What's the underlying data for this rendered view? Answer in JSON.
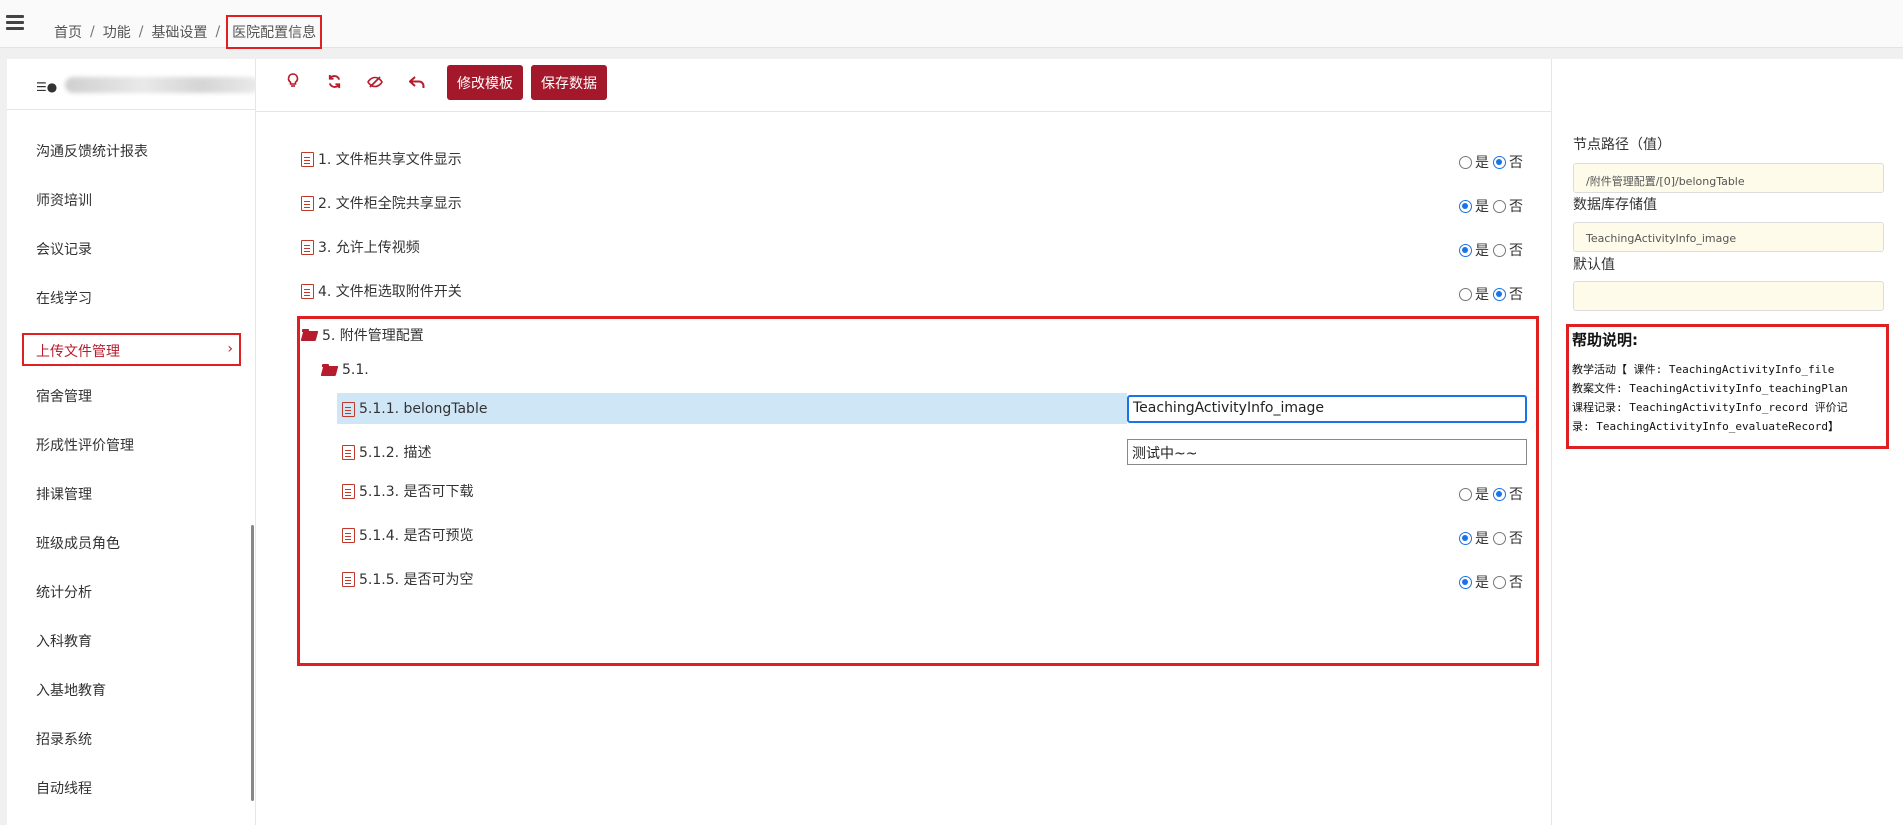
{
  "breadcrumb": {
    "items": [
      "首页",
      "功能",
      "基础设置"
    ],
    "current": "医院配置信息",
    "separator": "/"
  },
  "sidebar": {
    "header_icon": "server-icon",
    "items": [
      {
        "label": "沟通反馈统计报表"
      },
      {
        "label": "师资培训"
      },
      {
        "label": "会议记录"
      },
      {
        "label": "在线学习"
      },
      {
        "label": "上传文件管理",
        "active": true
      },
      {
        "label": "宿舍管理"
      },
      {
        "label": "形成性评价管理"
      },
      {
        "label": "排课管理"
      },
      {
        "label": "班级成员角色"
      },
      {
        "label": "统计分析"
      },
      {
        "label": "入科教育"
      },
      {
        "label": "入基地教育"
      },
      {
        "label": "招录系统"
      },
      {
        "label": "自动线程"
      }
    ]
  },
  "toolbar": {
    "icons": [
      "lightbulb-icon",
      "refresh-icon",
      "eye-slash-icon",
      "undo-icon"
    ],
    "edit_template_label": "修改模板",
    "save_data_label": "保存数据"
  },
  "tree": {
    "yes_label": "是",
    "no_label": "否",
    "items": [
      {
        "label": "1. 文件柜共享文件显示",
        "value": "否"
      },
      {
        "label": "2. 文件柜全院共享显示",
        "value": "是"
      },
      {
        "label": "3. 允许上传视频",
        "value": "是"
      },
      {
        "label": "4. 文件柜选取附件开关",
        "value": "否"
      }
    ],
    "group": {
      "label": "5. 附件管理配置",
      "sub_label": "5.1.",
      "children": [
        {
          "label": "5.1.1. belongTable",
          "input_value": "TeachingActivityInfo_image"
        },
        {
          "label": "5.1.2. 描述",
          "input_value": "测试中~~"
        },
        {
          "label": "5.1.3. 是否可下载",
          "value": "否"
        },
        {
          "label": "5.1.4. 是否可预览",
          "value": "是"
        },
        {
          "label": "5.1.5. 是否可为空",
          "value": "是"
        }
      ]
    }
  },
  "right_panel": {
    "node_path_label": "节点路径（值）",
    "node_path_value": "/附件管理配置/[0]/belongTable",
    "db_value_label": "数据库存储值",
    "db_value": "TeachingActivityInfo_image",
    "default_label": "默认值",
    "default_value": "",
    "help_title": "帮助说明:",
    "help_lines": [
      "教学活动【 课件: TeachingActivityInfo_file",
      "教案文件: TeachingActivityInfo_teachingPlan",
      "课程记录: TeachingActivityInfo_record  评价记",
      "录: TeachingActivityInfo_evaluateRecord】"
    ]
  },
  "colors": {
    "brand": "#a3192b",
    "highlight_border": "#e02020",
    "radio_checked": "#1a73e8",
    "selected_row": "#cfe6f7"
  }
}
